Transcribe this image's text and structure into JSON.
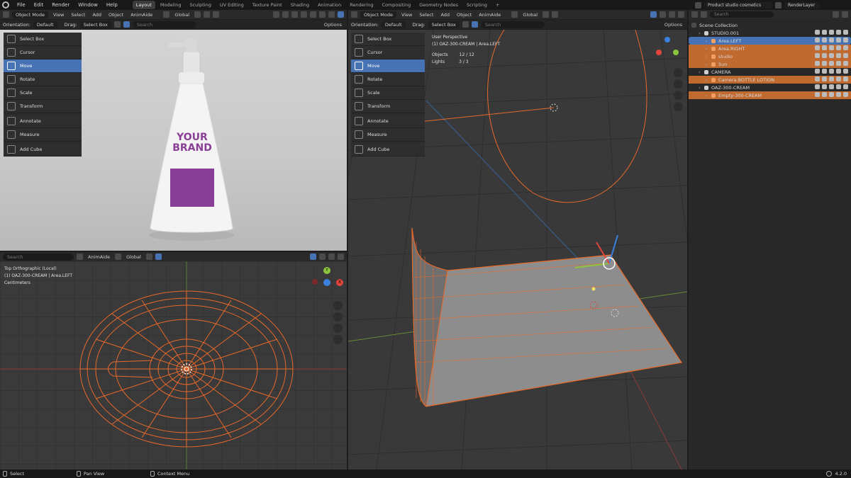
{
  "topbar": {
    "menus": [
      "File",
      "Edit",
      "Render",
      "Window",
      "Help"
    ],
    "tabs": [
      "Layout",
      "Modeling",
      "Sculpting",
      "UV Editing",
      "Texture Paint",
      "Shading",
      "Animation",
      "Rendering",
      "Compositing",
      "Geometry Nodes",
      "Scripting",
      "+"
    ],
    "active_tab": "Layout",
    "scene_name": "Product studio cosmetics",
    "view_layer": "RenderLayer"
  },
  "header": {
    "mode": "Object Mode",
    "view": "View",
    "select": "Select",
    "add": "Add",
    "object": "Object",
    "animaide": "AnimAide",
    "transform_orientation": "Global",
    "orientation_label": "Orientation:",
    "orientation_value": "Default",
    "drag_label": "Drag:",
    "drag_value": "Select Box",
    "search_placeholder": "Search",
    "options": "Options"
  },
  "tools": [
    "Select Box",
    "Cursor",
    "Move",
    "Rotate",
    "Scale",
    "Transform",
    "Annotate",
    "Measure",
    "Add Cube"
  ],
  "active_tool": "Move",
  "render_preview": {
    "brand_line1": "YOUR",
    "brand_line2": "BRAND",
    "label_color": "#8a3f96"
  },
  "top_ortho": {
    "line1": "Top Orthographic (Local)",
    "line2": "(1) OAZ-300-CREAM | Area.LEFT",
    "line3": "Centimeters",
    "search_placeholder": "Search",
    "animaide": "AnimAide",
    "orientation": "Global"
  },
  "persp": {
    "line1": "User Perspective",
    "line2": "(1) OAZ-300-CREAM | Area.LEFT",
    "objects_label": "Objects",
    "objects_value": "12 / 12",
    "lights_label": "Lights",
    "lights_value": "3 / 3"
  },
  "outliner": {
    "search_placeholder": "Search",
    "root": "Scene Collection",
    "rows": [
      {
        "label": "STUDIO.001",
        "indent": 1,
        "state": "normal"
      },
      {
        "label": "Area.LEFT",
        "indent": 2,
        "state": "selected"
      },
      {
        "label": "Area.RIGHT",
        "indent": 2,
        "state": "highlight"
      },
      {
        "label": "studio",
        "indent": 2,
        "state": "highlight"
      },
      {
        "label": "Sun",
        "indent": 2,
        "state": "highlight"
      },
      {
        "label": "CAMERA",
        "indent": 1,
        "state": "normal"
      },
      {
        "label": "Camera.BOTTLE LOTION",
        "indent": 2,
        "state": "highlight"
      },
      {
        "label": "OAZ-300-CREAM",
        "indent": 1,
        "state": "normal"
      },
      {
        "label": "Empty-300-CREAM",
        "indent": 2,
        "state": "highlight"
      }
    ]
  },
  "status": {
    "select": "Select",
    "pan": "Pan View",
    "context": "Context Menu",
    "version": "4.2.0"
  },
  "axes": {
    "x": "X",
    "y": "Y",
    "z": "Z"
  },
  "colors": {
    "accent": "#4772b3",
    "selection_orange": "#e8692a",
    "x_axis": "#e0443b",
    "y_axis": "#8cc63e",
    "z_axis": "#3b82e0"
  }
}
